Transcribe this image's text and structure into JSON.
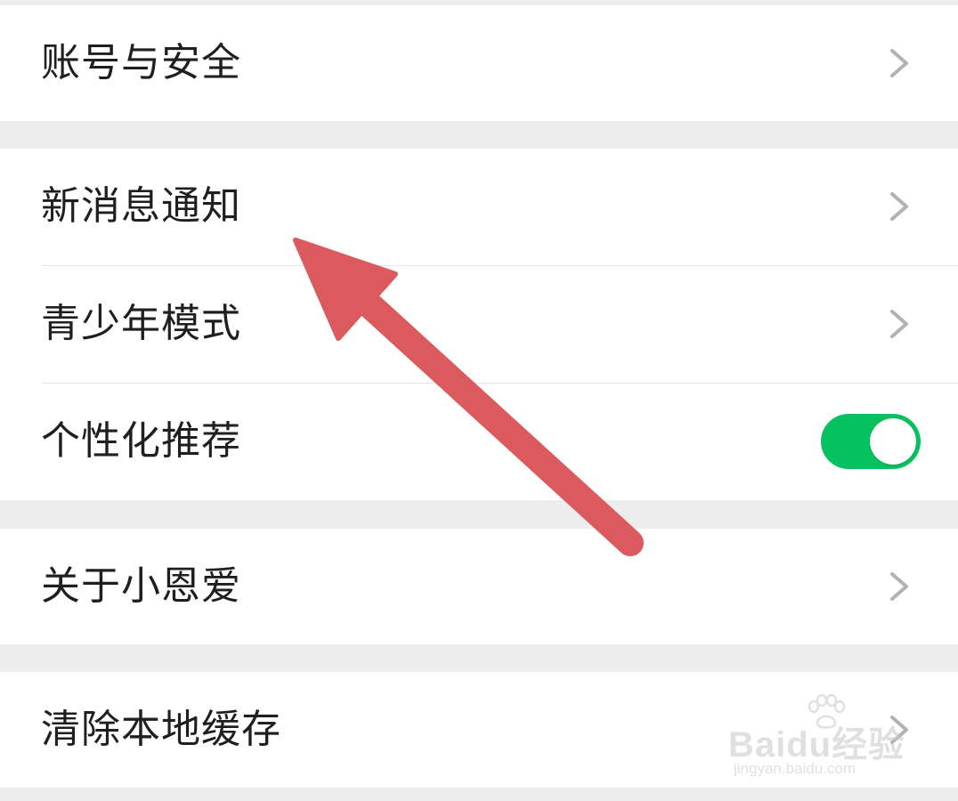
{
  "settings": {
    "items": [
      {
        "label": "账号与安全",
        "control": "chevron"
      },
      {
        "label": "新消息通知",
        "control": "chevron"
      },
      {
        "label": "青少年模式",
        "control": "chevron"
      },
      {
        "label": "个性化推荐",
        "control": "toggle",
        "toggle_on": true
      },
      {
        "label": "关于小恩爱",
        "control": "chevron"
      },
      {
        "label": "清除本地缓存",
        "control": "chevron"
      }
    ]
  },
  "annotation": {
    "arrow_color": "#db5a5e",
    "target": "新消息通知"
  },
  "watermark": {
    "brand": "Baidu经验",
    "url": "jingyan.baidu.com"
  },
  "colors": {
    "page_background": "#ededed",
    "cell_background": "#ffffff",
    "toggle_on": "#07c160",
    "chevron": "#b2b2b2",
    "text": "#1f1f1f"
  }
}
